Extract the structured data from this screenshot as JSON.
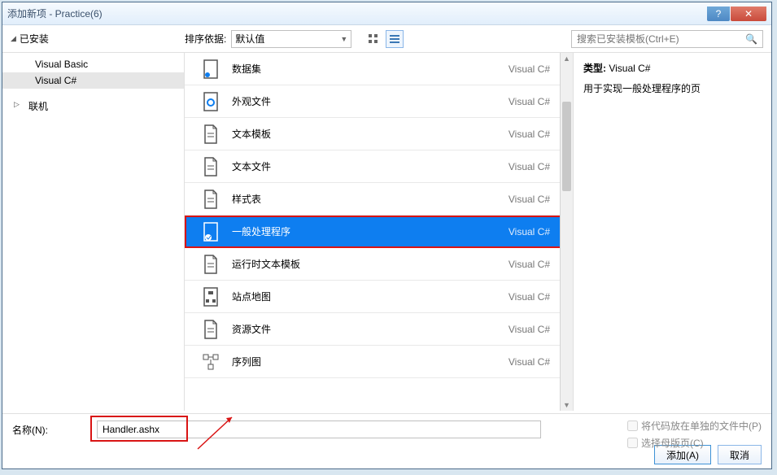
{
  "window": {
    "title": "添加新项 - Practice(6)"
  },
  "sidebar": {
    "installed": "已安装",
    "items": [
      "Visual Basic",
      "Visual C#"
    ],
    "online": "联机"
  },
  "sort": {
    "label": "排序依据:",
    "value": "默认值"
  },
  "search": {
    "placeholder": "搜索已安装模板(Ctrl+E)"
  },
  "templates": [
    {
      "label": "数据集",
      "lang": "Visual C#",
      "icon": "dataset"
    },
    {
      "label": "外观文件",
      "lang": "Visual C#",
      "icon": "skin"
    },
    {
      "label": "文本模板",
      "lang": "Visual C#",
      "icon": "doc"
    },
    {
      "label": "文本文件",
      "lang": "Visual C#",
      "icon": "doc"
    },
    {
      "label": "样式表",
      "lang": "Visual C#",
      "icon": "doc"
    },
    {
      "label": "一般处理程序",
      "lang": "Visual C#",
      "icon": "handler",
      "selected": true
    },
    {
      "label": "运行时文本模板",
      "lang": "Visual C#",
      "icon": "doc"
    },
    {
      "label": "站点地图",
      "lang": "Visual C#",
      "icon": "sitemap"
    },
    {
      "label": "资源文件",
      "lang": "Visual C#",
      "icon": "doc"
    },
    {
      "label": "序列图",
      "lang": "Visual C#",
      "icon": "diagram"
    }
  ],
  "details": {
    "type_label": "类型:",
    "type_value": "Visual C#",
    "description": "用于实现一般处理程序的页"
  },
  "name_label": "名称(N):",
  "name_value": "Handler.ashx",
  "checks": {
    "separate_file": "将代码放在单独的文件中(P)",
    "master_page": "选择母版页(C)"
  },
  "buttons": {
    "add": "添加(A)",
    "cancel": "取消"
  }
}
